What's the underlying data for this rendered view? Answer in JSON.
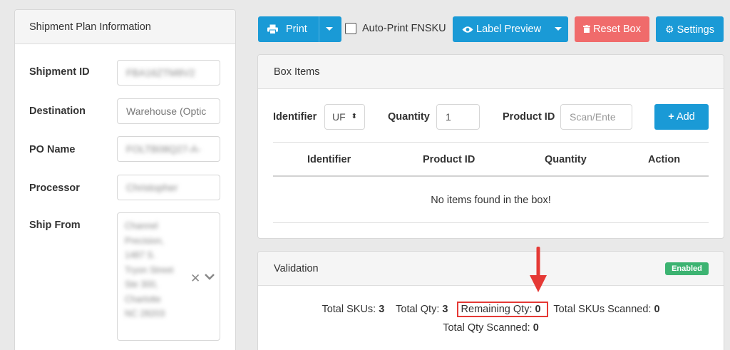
{
  "plan": {
    "header": "Shipment Plan Information",
    "fields": [
      {
        "label": "Shipment ID",
        "value": "FBA16ZTM8V2"
      },
      {
        "label": "Destination",
        "value": "Warehouse (Optic"
      },
      {
        "label": "PO Name",
        "value": "FOLTB08Q27-A-"
      },
      {
        "label": "Processor",
        "value": "Christopher"
      },
      {
        "label": "Ship From",
        "value": [
          "Channel",
          "Precision,",
          "1487 S.",
          "Tryon Street",
          "Ste 300,",
          "Charlotte",
          "NC 28203"
        ]
      }
    ]
  },
  "toolbar": {
    "print": "Print",
    "auto_print": "Auto-Print FNSKU",
    "label_preview": "Label Preview",
    "reset_box": "Reset Box",
    "settings": "Settings"
  },
  "box_items": {
    "header": "Box Items",
    "identifier_label": "Identifier",
    "identifier_value": "UF",
    "quantity_label": "Quantity",
    "quantity_value": "1",
    "product_id_label": "Product ID",
    "product_id_placeholder": "Scan/Ente",
    "add": "Add",
    "columns": [
      "Identifier",
      "Product ID",
      "Quantity",
      "Action"
    ],
    "empty": "No items found in the box!"
  },
  "validation": {
    "header": "Validation",
    "badge": "Enabled",
    "total_skus_label": "Total SKUs:",
    "total_skus": "3",
    "total_qty_label": "Total Qty:",
    "total_qty": "3",
    "remaining_label": "Remaining Qty:",
    "remaining": "0",
    "skus_scanned_label": "Total SKUs Scanned:",
    "skus_scanned": "0",
    "qty_scanned_label": "Total Qty Scanned:",
    "qty_scanned": "0"
  },
  "colors": {
    "primary": "#1a9ad6",
    "danger": "#f06b6b",
    "success": "#3cb371",
    "highlight": "#e53935"
  }
}
